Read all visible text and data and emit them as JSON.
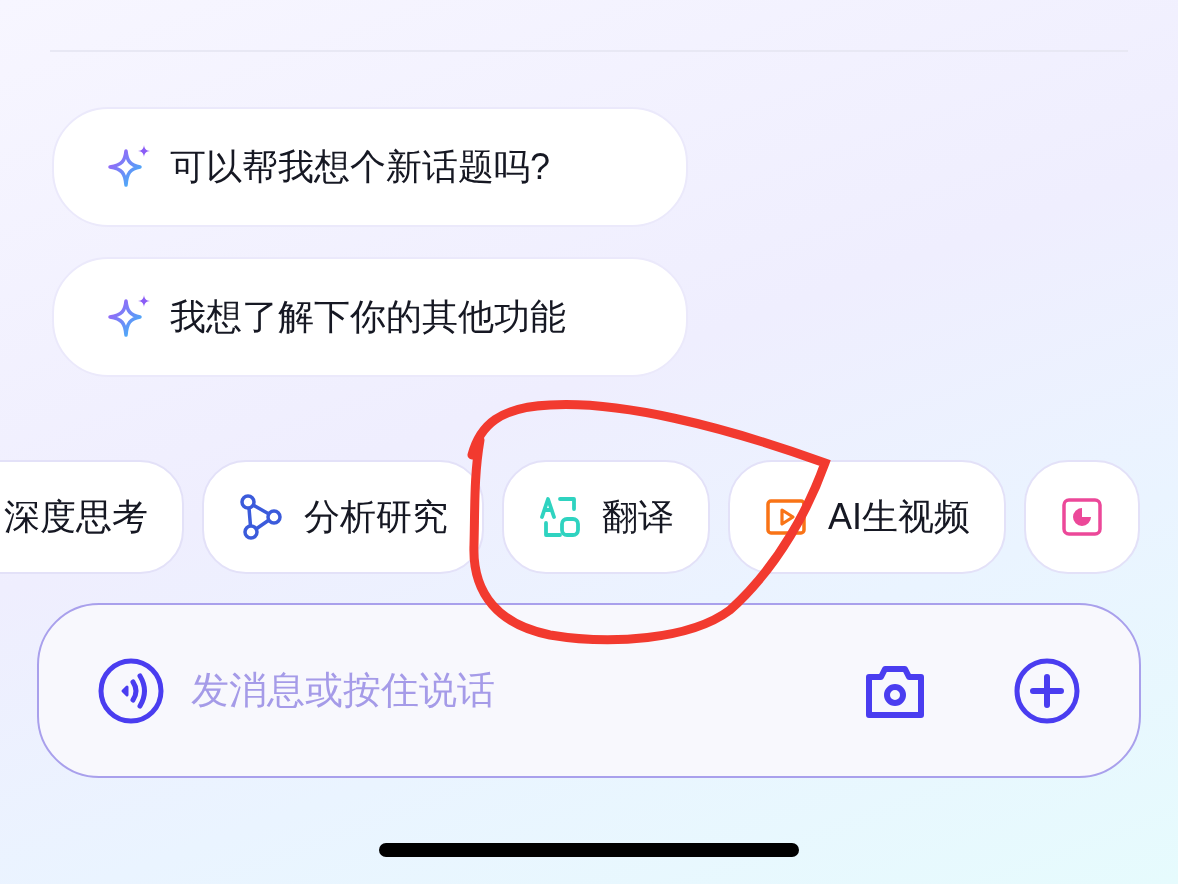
{
  "suggestions": [
    {
      "text": "可以帮我想个新话题吗?"
    },
    {
      "text": "我想了解下你的其他功能"
    }
  ],
  "skills": [
    {
      "kind": "think",
      "label": "深度思考"
    },
    {
      "kind": "research",
      "label": "分析研究"
    },
    {
      "kind": "translate",
      "label": "翻译"
    },
    {
      "kind": "video",
      "label": "AI生视频"
    },
    {
      "kind": "slides"
    }
  ],
  "composer": {
    "placeholder": "发消息或按住说话"
  }
}
